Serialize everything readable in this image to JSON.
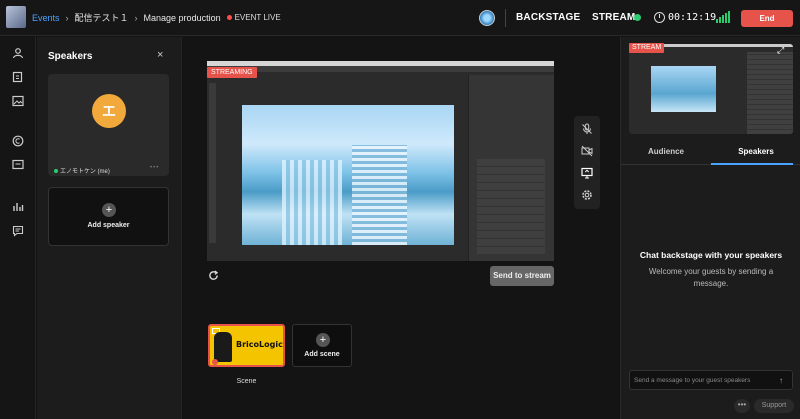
{
  "header": {
    "breadcrumbs": [
      "Events",
      "配信テスト１",
      "Manage production"
    ],
    "live_status": "EVENT LIVE",
    "backstage_label": "BACKSTAGE",
    "stream_label": "STREAM",
    "timer": "00:12:19",
    "end_label": "End",
    "accent_color": "#4aa3ff",
    "end_color": "#e5534b"
  },
  "left_nav": {
    "icons": [
      "user-icon",
      "document-stack-icon",
      "image-icon",
      "c-badge-icon",
      "comment-icon",
      "bar-chart-icon",
      "message-square-icon"
    ]
  },
  "speakers_panel": {
    "title": "Speakers",
    "close_label": "×",
    "speaker": {
      "initial": "エ",
      "name": "エノモトケン (me)",
      "more_label": "•••"
    },
    "add_speaker_label": "Add speaker",
    "avatar_color": "#f2a93b"
  },
  "stage": {
    "streaming_badge": "STREAMING",
    "send_to_stream_label": "Send to stream",
    "scene": {
      "label": "Scene",
      "brand_text": "BricoLogic"
    },
    "add_scene_label": "Add scene"
  },
  "right_panel": {
    "stream_badge": "STREAM",
    "tabs": [
      {
        "label": "Audience",
        "active": false
      },
      {
        "label": "Speakers",
        "active": true
      }
    ],
    "chat_title": "Chat backstage with your speakers",
    "chat_subtitle": "Welcome your guests by sending a message.",
    "message_placeholder": "Send a message to your guest speakers",
    "support_label": "Support",
    "more_label": "•••"
  }
}
